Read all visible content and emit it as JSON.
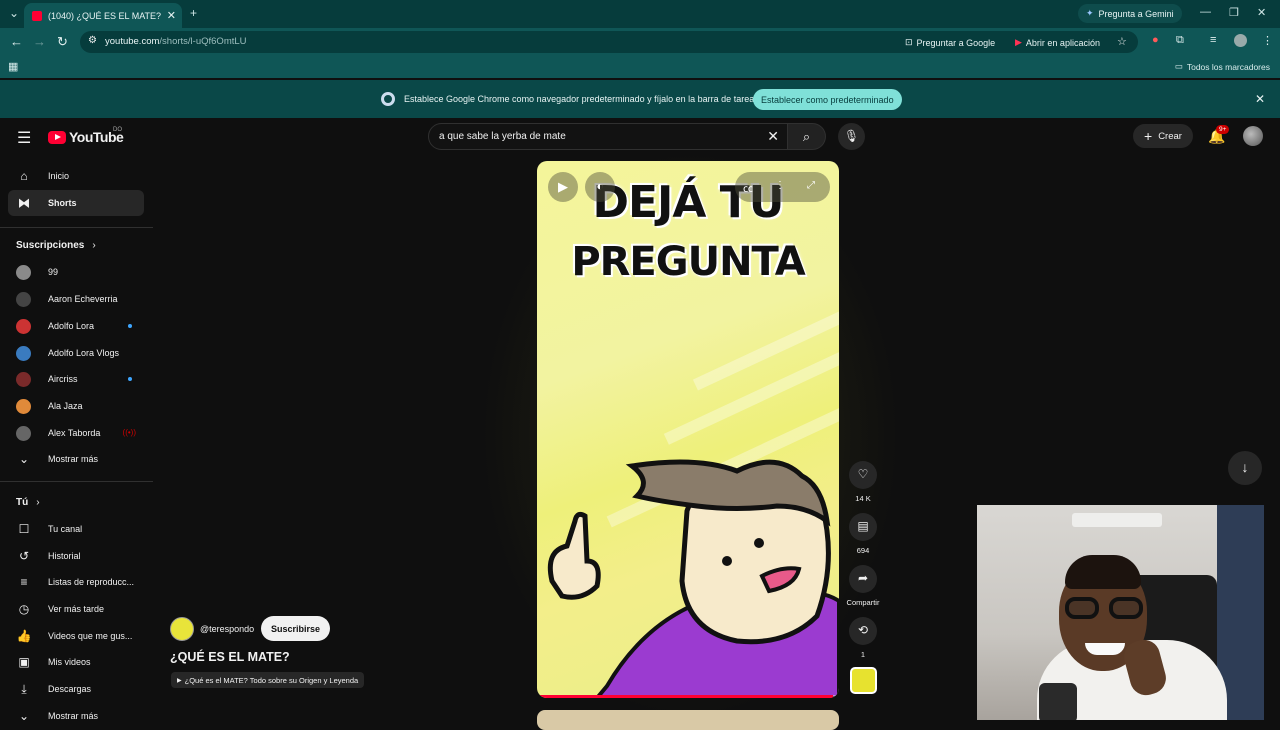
{
  "browser": {
    "tab_title": "(1040) ¿QUÉ ES EL MATE? - You",
    "url_host": "youtube.com",
    "url_path": "/shorts/l-uQf6OmtLU",
    "gemini_button": "Pregunta a Gemini",
    "ask_google": "Preguntar a Google",
    "open_in_app": "Abrir en aplicación",
    "all_bookmarks": "Todos los marcadores"
  },
  "infobar": {
    "message": "Establece Google Chrome como navegador predeterminado y fíjalo en la barra de tareas",
    "button": "Establecer como predeterminado"
  },
  "youtube": {
    "logo": "YouTube",
    "country": "DO",
    "search_query": "a que sabe la yerba de mate",
    "create": "Crear",
    "notif_badge": "9+"
  },
  "sidebar": {
    "main": [
      {
        "label": "Inicio",
        "icon": "home-icon"
      },
      {
        "label": "Shorts",
        "icon": "shorts-icon"
      }
    ],
    "subscriptions_title": "Suscripciones",
    "subscriptions": [
      {
        "label": "99"
      },
      {
        "label": "Aaron Echeverria"
      },
      {
        "label": "Adolfo Lora"
      },
      {
        "label": "Adolfo Lora Vlogs"
      },
      {
        "label": "Aircriss"
      },
      {
        "label": "Ala Jaza"
      },
      {
        "label": "Alex Taborda"
      }
    ],
    "show_more": "Mostrar más",
    "you_title": "Tú",
    "you_items": [
      {
        "label": "Tu canal",
        "icon": "channel-icon"
      },
      {
        "label": "Historial",
        "icon": "history-icon"
      },
      {
        "label": "Listas de reproducc...",
        "icon": "playlists-icon"
      },
      {
        "label": "Ver más tarde",
        "icon": "watch-later-icon"
      },
      {
        "label": "Videos que me gus...",
        "icon": "liked-icon"
      },
      {
        "label": "Mis videos",
        "icon": "my-videos-icon"
      },
      {
        "label": "Descargas",
        "icon": "downloads-icon"
      }
    ],
    "show_more_2": "Mostrar más"
  },
  "short": {
    "overlay_line1": "DEJÁ TU",
    "overlay_line2": "PREGUNTA",
    "progress": 0.98,
    "likes": "14 K",
    "comments": "694",
    "share": "Compartir",
    "remix": "1",
    "channel": "@terespondo",
    "subscribe": "Suscribirse",
    "title": "¿QUÉ ES EL MATE?",
    "related": "¿Qué es el MATE? Todo sobre su Origen y Leyenda"
  },
  "colors": {
    "accent": "#ff0033",
    "chrome_frame": "#063c3c",
    "chrome_toolbar": "#0f5656",
    "infobar_button": "#7fe0d8",
    "video_bg": "#f2f3a0"
  }
}
